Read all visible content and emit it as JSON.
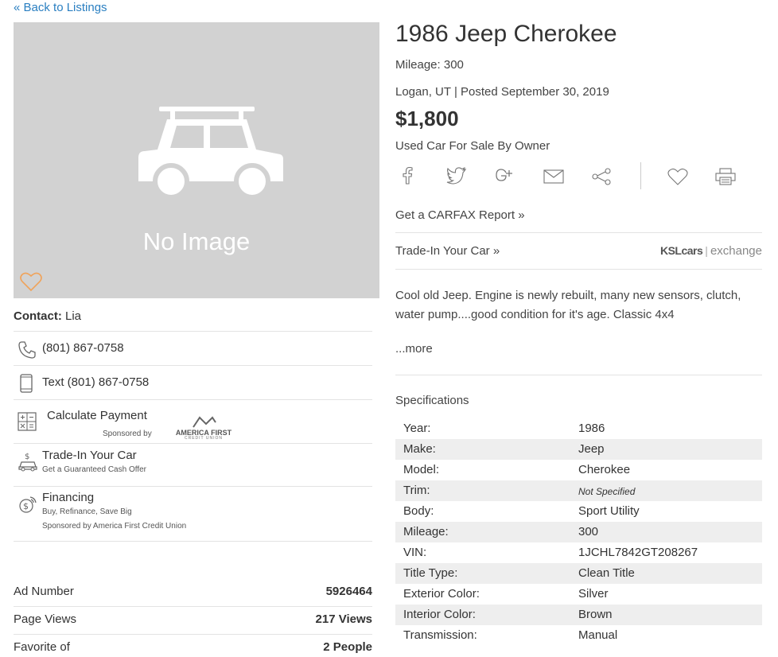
{
  "nav": {
    "back_label": "« Back to Listings"
  },
  "photo": {
    "no_image_text": "No Image"
  },
  "listing": {
    "title": "1986 Jeep Cherokee",
    "mileage_line": "Mileage: 300",
    "location_line": "Logan, UT | Posted September 30, 2019",
    "price": "$1,800",
    "sale_type": "Used Car For Sale By Owner",
    "carfax_link": "Get a CARFAX Report »",
    "tradein_link": "Trade-In Your Car »",
    "exchange_logo_ksl": "KSLcars",
    "exchange_logo_word": "exchange",
    "description": "Cool old Jeep. Engine is newly rebuilt, many new sensors, clutch, water pump....good condition for it's age. Classic 4x4",
    "more_link": "...more"
  },
  "contact": {
    "label": "Contact:",
    "name": "Lia",
    "phone": "(801) 867-0758",
    "text_phone": "Text (801) 867-0758",
    "calc_label": "Calculate Payment",
    "calc_sponsor": "Sponsored by",
    "sponsor_logo": "AMERICA FIRST",
    "sponsor_logo_sub": "CREDIT UNION",
    "tradein_label": "Trade-In Your Car",
    "tradein_sub": "Get a Guaranteed Cash Offer",
    "financing_label": "Financing",
    "financing_sub": "Buy, Refinance, Save Big",
    "financing_sponsor": "Sponsored by America First Credit Union"
  },
  "stats": {
    "ad_number_label": "Ad Number",
    "ad_number": "5926464",
    "views_label": "Page Views",
    "views": "217 Views",
    "favorite_label": "Favorite of",
    "favorite": "2 People"
  },
  "specs_title": "Specifications",
  "specs": [
    {
      "label": "Year:",
      "value": "1986"
    },
    {
      "label": "Make:",
      "value": "Jeep"
    },
    {
      "label": "Model:",
      "value": "Cherokee"
    },
    {
      "label": "Trim:",
      "value": "Not Specified"
    },
    {
      "label": "Body:",
      "value": "Sport Utility"
    },
    {
      "label": "Mileage:",
      "value": "300"
    },
    {
      "label": "VIN:",
      "value": "1JCHL7842GT208267"
    },
    {
      "label": "Title Type:",
      "value": "Clean Title"
    },
    {
      "label": "Exterior Color:",
      "value": "Silver"
    },
    {
      "label": "Interior Color:",
      "value": "Brown"
    },
    {
      "label": "Transmission:",
      "value": "Manual"
    }
  ],
  "icons": {
    "share": [
      "facebook-icon",
      "twitter-icon",
      "google-plus-icon",
      "email-icon",
      "share-icon"
    ],
    "actions": [
      "heart-icon",
      "print-icon"
    ]
  },
  "colors": {
    "link": "#2a7fc1",
    "favorite": "#f0a35a",
    "photo_bg": "#d2d2d2"
  }
}
